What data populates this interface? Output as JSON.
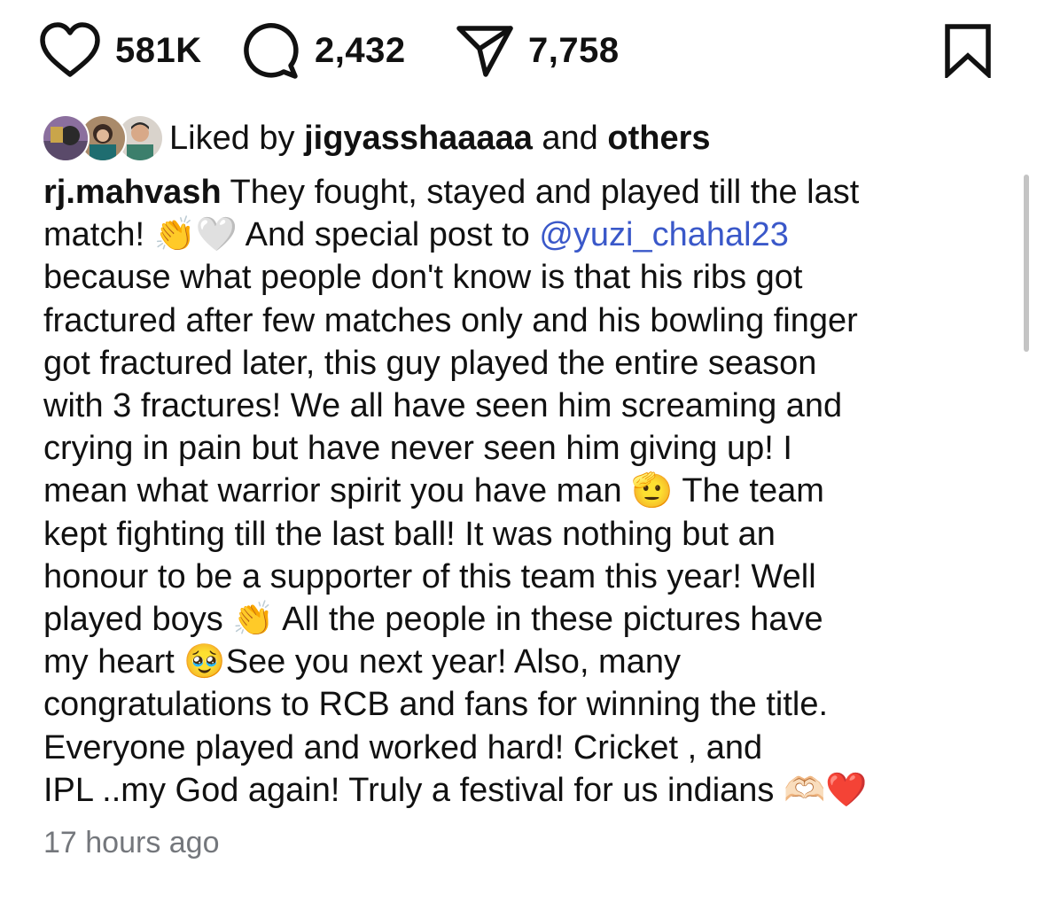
{
  "actions": {
    "like": {
      "icon": "heart-icon",
      "count": "581K"
    },
    "comment": {
      "icon": "comment-bubble-icon",
      "count": "2,432"
    },
    "share": {
      "icon": "paper-plane-icon",
      "count": "7,758"
    },
    "save": {
      "icon": "bookmark-icon"
    }
  },
  "liked_by": {
    "prefix": "Liked by ",
    "user": "jigyasshaaaaa",
    "middle": " and ",
    "others": "others"
  },
  "caption": {
    "username": "rj.mahvash",
    "lines": {
      "l1": " They fought, stayed and played till the last",
      "l2a": "match! 👏🤍 And special post to ",
      "mention": "@yuzi_chahal23",
      "l3": "because what people don't know is that his ribs got",
      "l4": "fractured after few matches only and his bowling finger",
      "l5": "got fractured later, this guy played the entire season",
      "l6": "with 3 fractures! We all have seen him screaming and",
      "l7": "crying in pain but have never seen him giving up! I",
      "l8": "mean what warrior spirit you have man 🫡 The team",
      "l9": "kept fighting till the last ball! It was nothing but an",
      "l10": "honour to be a supporter of this team this year! Well",
      "l11": "played boys 👏 All the people in these pictures have",
      "l12": "my heart 🥹See you next year!  Also, many",
      "l13": "congratulations to RCB and  fans for winning the title.",
      "l14": "Everyone played and worked hard! Cricket , and",
      "l15": "IPL ..my God again! Truly a festival for us indians 🫶🏻❤️"
    }
  },
  "timestamp": "17 hours ago",
  "colors": {
    "text": "#111111",
    "mention": "#3a58c9",
    "muted": "#74777c",
    "background": "#ffffff"
  }
}
